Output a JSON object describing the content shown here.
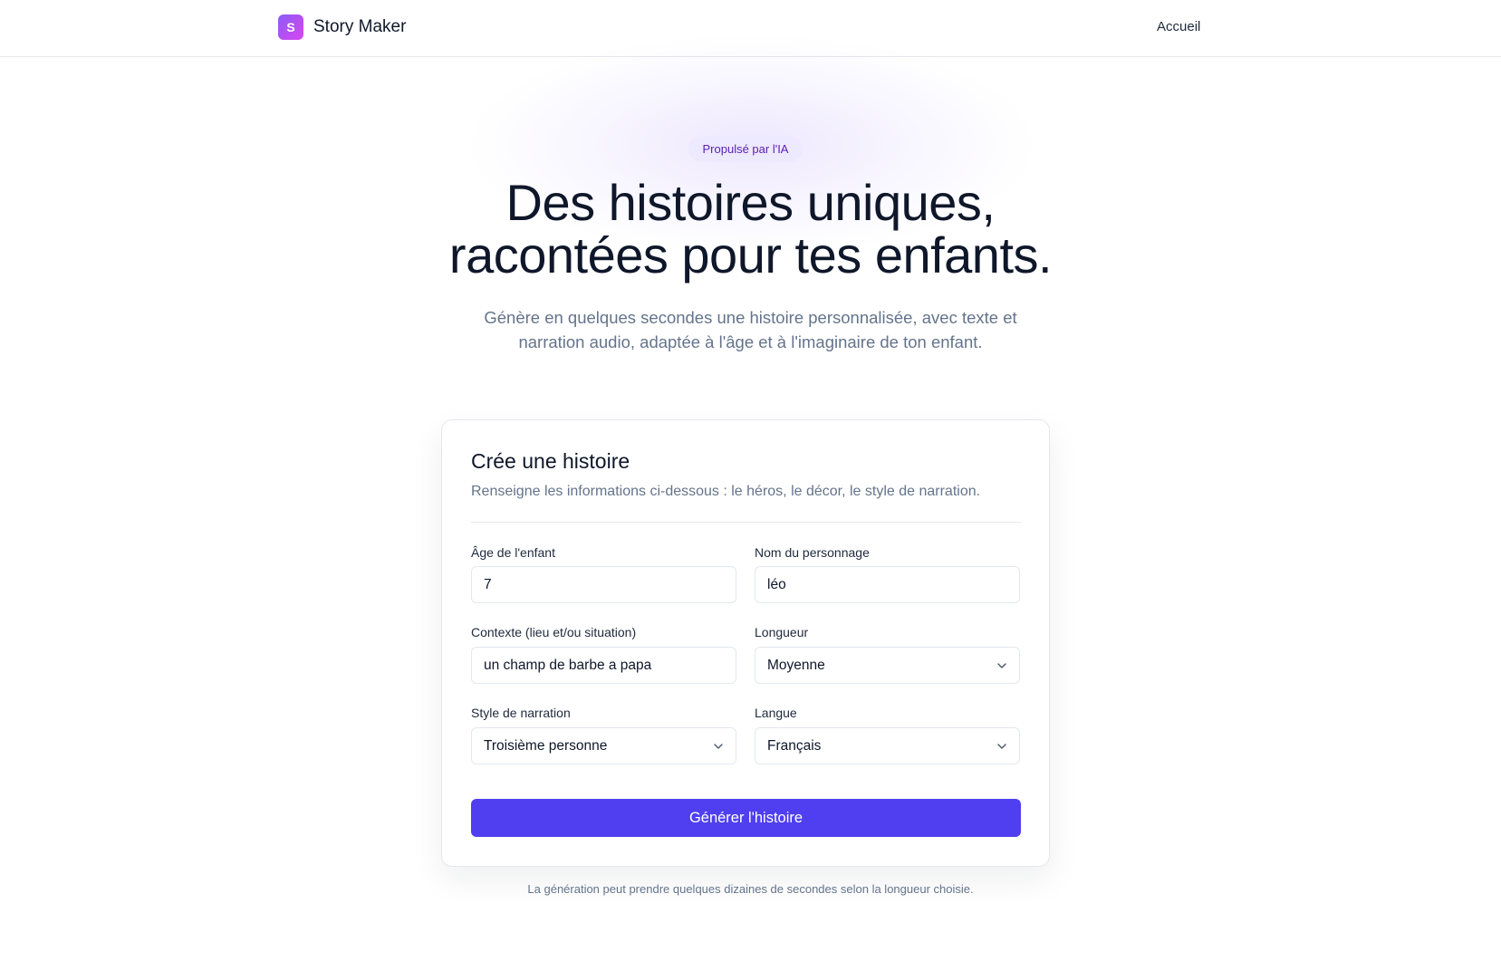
{
  "header": {
    "logo_letter": "S",
    "brand_name": "Story Maker",
    "nav_home": "Accueil"
  },
  "hero": {
    "badge": "Propulsé par l'IA",
    "title_line1": "Des histoires uniques,",
    "title_line2": "racontées pour tes enfants.",
    "subtitle_line1": "Génère en quelques secondes une histoire personnalisée, avec texte et",
    "subtitle_line2": "narration audio, adaptée à l'âge et à l'imaginaire de ton enfant."
  },
  "form": {
    "title": "Crée une histoire",
    "description": "Renseigne les informations ci-dessous : le héros, le décor, le style de narration.",
    "age": {
      "label": "Âge de l'enfant",
      "value": "7"
    },
    "character": {
      "label": "Nom du personnage",
      "value": "léo"
    },
    "context": {
      "label": "Contexte (lieu et/ou situation)",
      "value": "un champ de barbe a papa"
    },
    "length": {
      "label": "Longueur",
      "value": "Moyenne"
    },
    "style": {
      "label": "Style de narration",
      "value": "Troisième personne"
    },
    "language": {
      "label": "Langue",
      "value": "Français"
    },
    "submit_label": "Générer l'histoire"
  },
  "footnote": "La génération peut prendre quelques dizaines de secondes selon la longueur choisie.",
  "colors": {
    "accent": "#4f3ff0",
    "badge_bg": "#ede9fe",
    "badge_text": "#5b21b6",
    "logo_gradient_start": "#8b5cf6",
    "logo_gradient_end": "#d946ef"
  }
}
